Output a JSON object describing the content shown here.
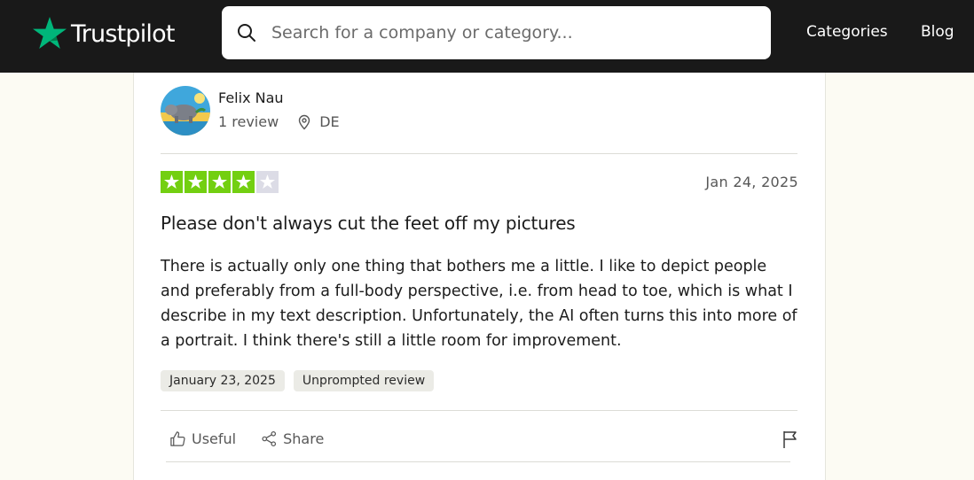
{
  "header": {
    "logo_text": "Trustpilot",
    "search": {
      "placeholder": "Search for a company or category..."
    },
    "nav": {
      "categories": "Categories",
      "blog": "Blog"
    }
  },
  "review": {
    "user": {
      "name": "Felix Nau",
      "reviews": "1 review",
      "country": "DE"
    },
    "rating": 4,
    "rating_max": 5,
    "date": "Jan 24, 2025",
    "title": "Please don't always cut the feet off my pictures",
    "body": "There is actually only one thing that bothers me a little. I like to depict people and preferably from a full-body perspective, i.e. from head to toe, which is what I describe in my text description. Unfortunately, the AI often turns this into more of a portrait. I think there's still a little room for improvement.",
    "tags": {
      "experience_date": "January 23, 2025",
      "type": "Unprompted review"
    },
    "actions": {
      "useful": "Useful",
      "share": "Share"
    }
  },
  "colors": {
    "brand_green": "#00b67a",
    "star_green": "#73cf11",
    "star_empty": "#dcdce6",
    "header_bg": "#191919"
  }
}
